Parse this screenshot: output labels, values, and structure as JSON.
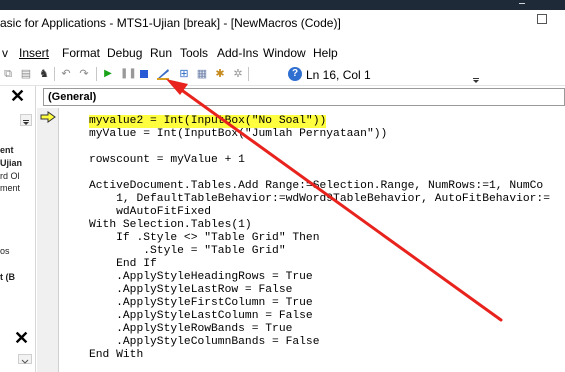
{
  "window": {
    "title": "asic for Applications - MTS1-Ujian [break] - [NewMacros (Code)]"
  },
  "menu": {
    "items": [
      "v",
      "Insert",
      "Format",
      "Debug",
      "Run",
      "Tools",
      "Add-Ins",
      "Window",
      "Help"
    ]
  },
  "toolbar": {
    "help_glyph": "?",
    "cursor_position": "Ln 16, Col 1"
  },
  "left_panel": {
    "labels": [
      "ent",
      "Ujian",
      "rd Ol",
      "ment",
      "os",
      "t (B"
    ]
  },
  "editor": {
    "object_combo": "(General)",
    "code_lines": [
      "myvalue2 = Int(InputBox(\"No Soal\"))",
      "myValue = Int(InputBox(\"Jumlah Pernyataan\"))",
      "",
      "rowscount = myValue + 1",
      "",
      "ActiveDocument.Tables.Add Range:=Selection.Range, NumRows:=1, NumCo",
      "    1, DefaultTableBehavior:=wdWord9TableBehavior, AutoFitBehavior:=",
      "    wdAutoFitFixed",
      "With Selection.Tables(1)",
      "    If .Style <> \"Table Grid\" Then",
      "        .Style = \"Table Grid\"",
      "    End If",
      "    .ApplyStyleHeadingRows = True",
      "    .ApplyStyleLastRow = False",
      "    .ApplyStyleFirstColumn = True",
      "    .ApplyStyleLastColumn = False",
      "    .ApplyStyleRowBands = True",
      "    .ApplyStyleColumnBands = False",
      "End With"
    ]
  },
  "colors": {
    "highlight": "#ffff3f",
    "annotation_arrow": "#e8231e",
    "help_icon": "#2f6fd0"
  }
}
